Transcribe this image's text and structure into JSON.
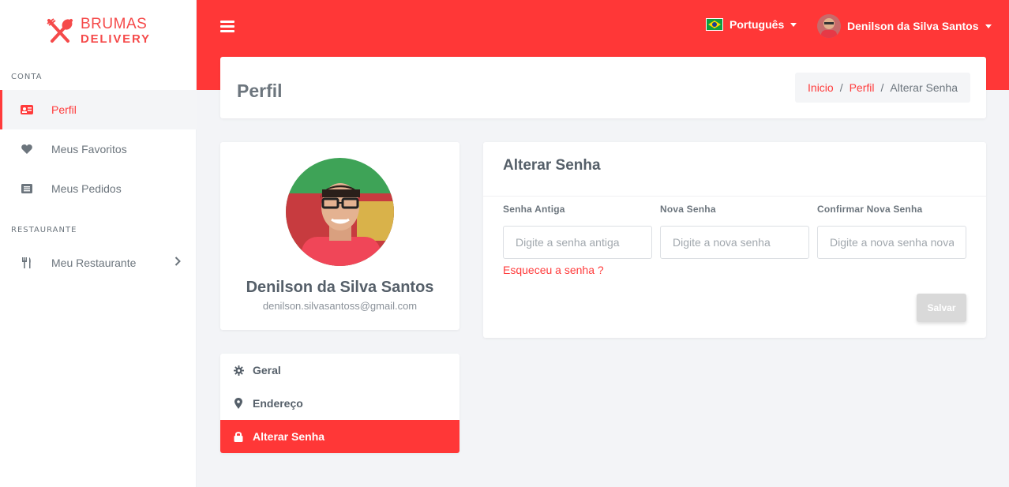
{
  "brand": {
    "line1": "BRUMAS",
    "line2": "DELIVERY",
    "color": "#f54a4a"
  },
  "sidebar": {
    "section_account": "CONTA",
    "section_restaurant": "RESTAURANTE",
    "items": [
      {
        "label": "Perfil",
        "icon": "id-card-icon",
        "active": true
      },
      {
        "label": "Meus Favoritos",
        "icon": "heart-icon",
        "active": false
      },
      {
        "label": "Meus Pedidos",
        "icon": "list-icon",
        "active": false
      },
      {
        "label": "Meu Restaurante",
        "icon": "utensils-icon",
        "active": false
      }
    ]
  },
  "topbar": {
    "language": "Português",
    "user_name": "Denilson da Silva Santos",
    "accent": "#ff3737"
  },
  "header": {
    "title": "Perfil",
    "breadcrumb": {
      "home": "Inicio",
      "profile": "Perfil",
      "current": "Alterar Senha",
      "separator": "/"
    }
  },
  "profile": {
    "name": "Denilson da Silva Santos",
    "email": "denilson.silvasantoss@gmail.com"
  },
  "profile_menu": [
    {
      "label": "Geral",
      "icon": "gear-icon"
    },
    {
      "label": "Endereço",
      "icon": "map-marker-icon"
    },
    {
      "label": "Alterar Senha",
      "icon": "lock-icon",
      "active": true
    }
  ],
  "password_form": {
    "title": "Alterar Senha",
    "old_label": "Senha Antiga",
    "old_placeholder": "Digite a senha antiga",
    "new_label": "Nova Senha",
    "new_placeholder": "Digite a nova senha",
    "confirm_label": "Confirmar Nova Senha",
    "confirm_placeholder": "Digite a nova senha novamente",
    "forgot_link": "Esqueceu a senha ?",
    "save_label": "Salvar"
  }
}
